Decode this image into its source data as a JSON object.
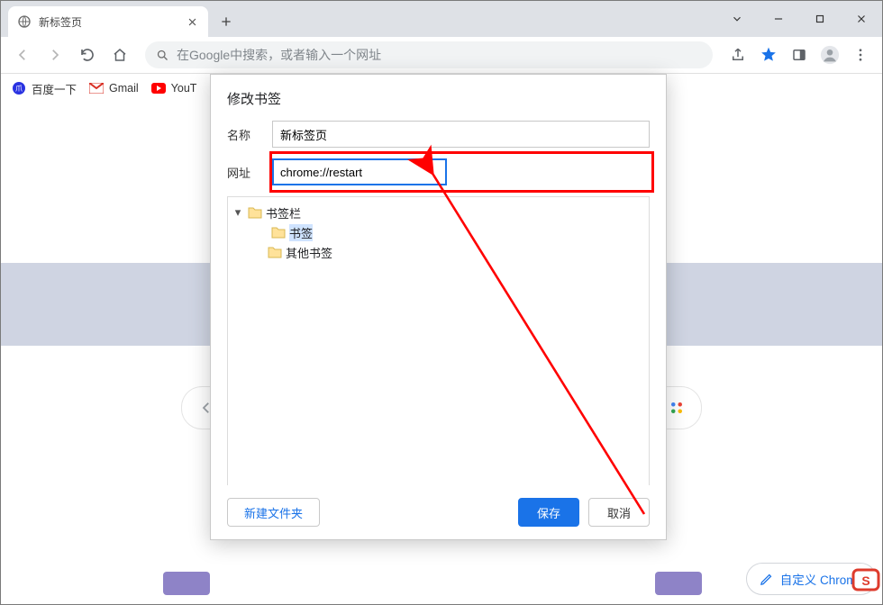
{
  "tab": {
    "title": "新标签页"
  },
  "omnibox": {
    "placeholder": "在Google中搜索，或者输入一个网址"
  },
  "bookmarks_bar": {
    "items": [
      {
        "label": "百度一下",
        "icon": "baidu"
      },
      {
        "label": "Gmail",
        "icon": "gmail"
      },
      {
        "label": "YouT",
        "icon": "youtube"
      }
    ]
  },
  "customize_label": "自定义 Chrome",
  "dialog": {
    "title": "修改书签",
    "name_label": "名称",
    "name_value": "新标签页",
    "url_label": "网址",
    "url_value": "chrome://restart",
    "tree": {
      "root": "书签栏",
      "child": "书签",
      "other": "其他书签"
    },
    "new_folder": "新建文件夹",
    "save": "保存",
    "cancel": "取消"
  },
  "colors": {
    "accent": "#1a73e8",
    "annotation": "#ff0000",
    "star_active": "#1a73e8"
  }
}
